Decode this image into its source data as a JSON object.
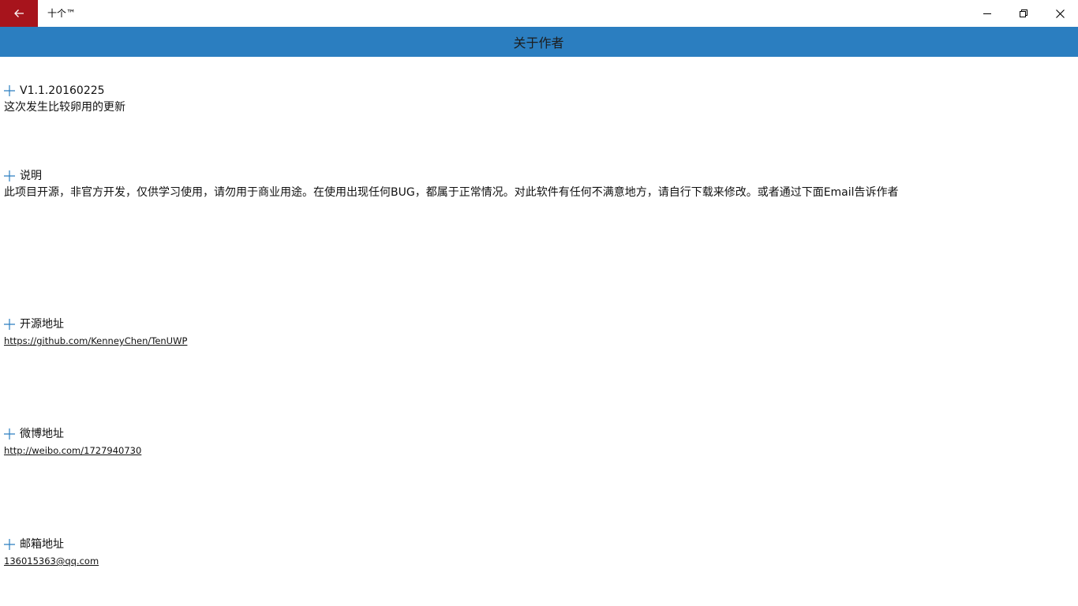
{
  "titlebar": {
    "app_title": "十个™"
  },
  "header": {
    "title": "关于作者"
  },
  "sections": [
    {
      "title": "V1.1.20160225",
      "body": "这次发生比较卵用的更新"
    },
    {
      "title": "说明",
      "body": "此项目开源，非官方开发，仅供学习使用，请勿用于商业用途。在使用出现任何BUG，都属于正常情况。对此软件有任何不满意地方，请自行下载来修改。或者通过下面Email告诉作者"
    },
    {
      "title": "开源地址",
      "link": "https://github.com/KenneyChen/TenUWP"
    },
    {
      "title": "微博地址",
      "link": "http://weibo.com/1727940730"
    },
    {
      "title": "邮箱地址",
      "link": "136015363@qq.com"
    }
  ],
  "colors": {
    "accent": "#2b7ec0",
    "back_button": "#a7141c"
  },
  "icons": {
    "back": "arrow-left-icon",
    "minimize": "minimize-icon",
    "maximize": "restore-icon",
    "close": "close-icon",
    "expand": "plus-icon"
  }
}
